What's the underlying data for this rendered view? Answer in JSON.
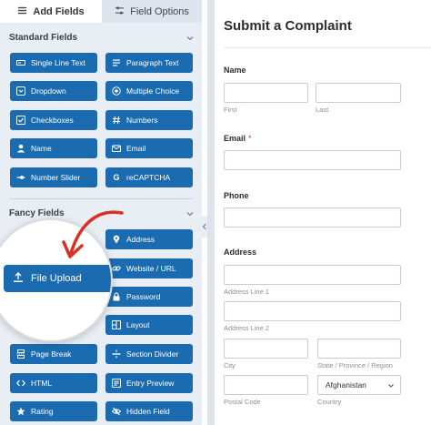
{
  "tabs": {
    "add_fields": "Add Fields",
    "field_options": "Field Options"
  },
  "standard": {
    "title": "Standard Fields",
    "buttons": [
      {
        "label": "Single Line Text",
        "icon": "text-line-icon"
      },
      {
        "label": "Paragraph Text",
        "icon": "paragraph-icon"
      },
      {
        "label": "Dropdown",
        "icon": "dropdown-icon"
      },
      {
        "label": "Multiple Choice",
        "icon": "radio-icon"
      },
      {
        "label": "Checkboxes",
        "icon": "checkbox-icon"
      },
      {
        "label": "Numbers",
        "icon": "hash-icon"
      },
      {
        "label": "Name",
        "icon": "user-icon"
      },
      {
        "label": "Email",
        "icon": "envelope-icon"
      },
      {
        "label": "Number Slider",
        "icon": "slider-icon"
      },
      {
        "label": "reCAPTCHA",
        "icon": "google-icon"
      }
    ]
  },
  "fancy": {
    "title": "Fancy Fields",
    "buttons": [
      {
        "label": "Address",
        "icon": "map-pin-icon"
      },
      {
        "label": "Website / URL",
        "icon": "link-icon"
      },
      {
        "label": "Password",
        "icon": "lock-icon"
      },
      {
        "label": "Layout",
        "icon": "layout-icon"
      },
      {
        "label": "Page Break",
        "icon": "page-break-icon"
      },
      {
        "label": "Section Divider",
        "icon": "divider-icon"
      },
      {
        "label": "HTML",
        "icon": "code-icon"
      },
      {
        "label": "Entry Preview",
        "icon": "preview-icon"
      },
      {
        "label": "Rating",
        "icon": "star-icon"
      },
      {
        "label": "Hidden Field",
        "icon": "eye-slash-icon"
      }
    ],
    "highlight": {
      "label": "File Upload",
      "icon": "upload-icon"
    }
  },
  "form": {
    "title": "Submit a Complaint",
    "name": {
      "label": "Name",
      "first": "First",
      "last": "Last"
    },
    "email": {
      "label": "Email",
      "required": "*"
    },
    "phone": {
      "label": "Phone"
    },
    "address": {
      "label": "Address",
      "line1": "Address Line 1",
      "line2": "Address Line 2",
      "city": "City",
      "state": "State / Province / Region",
      "postal": "Postal Code",
      "country": "Country",
      "country_value": "Afghanistan"
    }
  },
  "colors": {
    "button_blue": "#1b6bb0",
    "panel_bg": "#e8eef4",
    "arrow_red": "#d93025"
  }
}
